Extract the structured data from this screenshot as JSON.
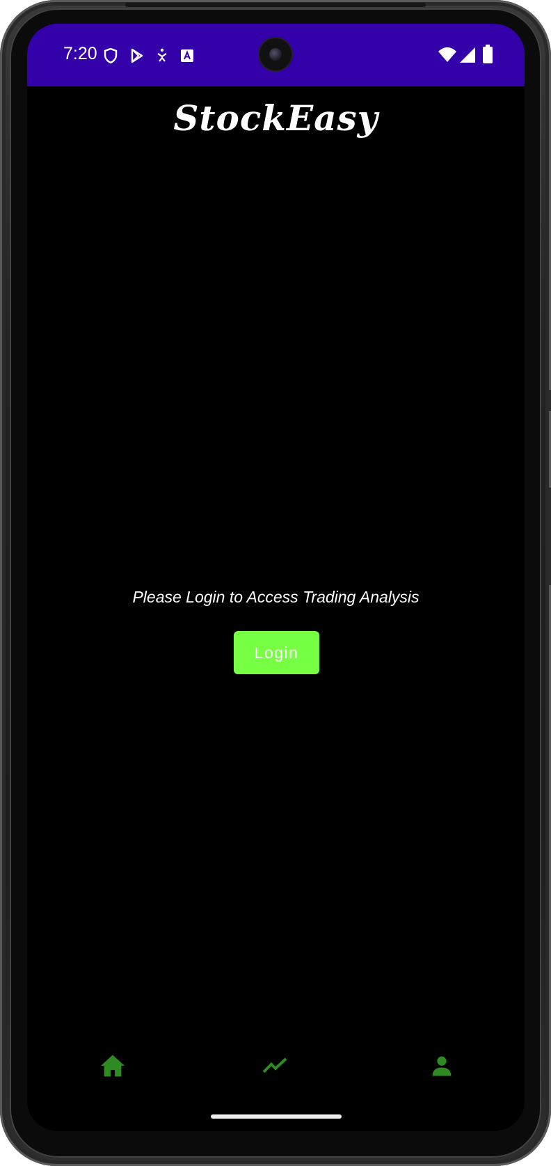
{
  "status_bar": {
    "time": "7:20",
    "background_color": "#3300aa",
    "left_icons": [
      "shield-icon",
      "play-store-icon",
      "accessibility-icon",
      "translate-icon"
    ],
    "right_icons": [
      "wifi-icon",
      "signal-icon",
      "battery-icon"
    ]
  },
  "app": {
    "title": "StockEasy"
  },
  "main": {
    "prompt": "Please Login to Access Trading Analysis",
    "login_label": "Login",
    "login_color": "#77ff44"
  },
  "bottom_nav": {
    "items": [
      {
        "icon": "home-icon",
        "color": "#2e8b22"
      },
      {
        "icon": "trending-up-icon",
        "color": "#2e8b22"
      },
      {
        "icon": "person-icon",
        "color": "#2e8b22"
      }
    ]
  }
}
